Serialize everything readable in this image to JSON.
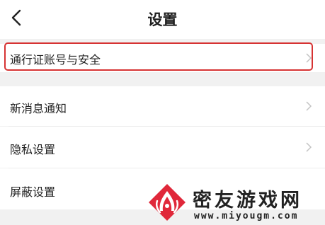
{
  "header": {
    "title": "设置",
    "back_icon": "chevron-left-icon"
  },
  "settings": {
    "items": [
      {
        "label": "通行证账号与安全",
        "icon": "chevron-right-icon",
        "highlighted": true
      },
      {
        "label": "新消息通知",
        "icon": "chevron-right-icon"
      },
      {
        "label": "隐私设置",
        "icon": "chevron-right-icon"
      },
      {
        "label": "屏蔽设置",
        "icon": "chevron-right-icon"
      }
    ]
  },
  "watermark": {
    "name": "密友游戏网",
    "url": "www.miyougm.com"
  },
  "colors": {
    "highlight": "#d63333",
    "background": "#f1f1f1",
    "row": "#ffffff",
    "logo": "#e0283a",
    "chevron": "#c4c4c4"
  }
}
